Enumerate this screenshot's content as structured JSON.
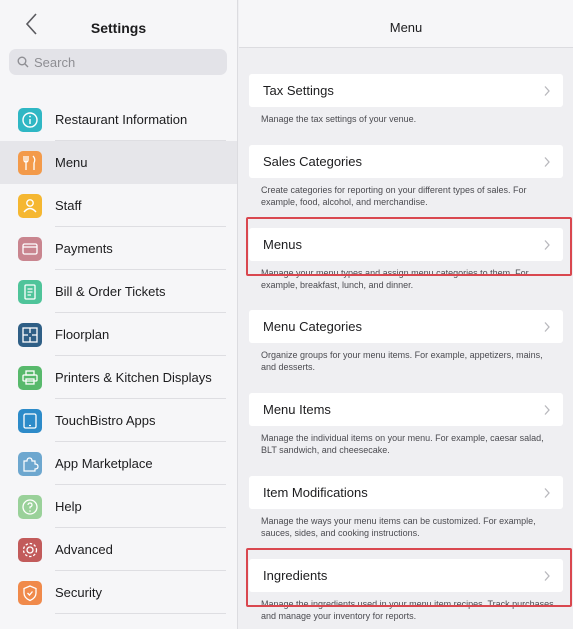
{
  "left": {
    "title": "Settings",
    "search_placeholder": "Search",
    "items": [
      {
        "label": "Restaurant Information",
        "icon": "info-icon",
        "color": "#2fb7c4",
        "selected": false
      },
      {
        "label": "Menu",
        "icon": "fork-knife-icon",
        "color": "#f39a4a",
        "selected": true
      },
      {
        "label": "Staff",
        "icon": "person-icon",
        "color": "#f5b731",
        "selected": false
      },
      {
        "label": "Payments",
        "icon": "wallet-icon",
        "color": "#c9858f",
        "selected": false
      },
      {
        "label": "Bill & Order Tickets",
        "icon": "receipt-icon",
        "color": "#4fc49a",
        "selected": false
      },
      {
        "label": "Floorplan",
        "icon": "floorplan-icon",
        "color": "#2f5f86",
        "selected": false
      },
      {
        "label": "Printers & Kitchen Displays",
        "icon": "printer-icon",
        "color": "#58b96c",
        "selected": false
      },
      {
        "label": "TouchBistro Apps",
        "icon": "tablet-icon",
        "color": "#2d8bc9",
        "selected": false
      },
      {
        "label": "App Marketplace",
        "icon": "puzzle-icon",
        "color": "#6da7cf",
        "selected": false
      },
      {
        "label": "Help",
        "icon": "help-icon",
        "color": "#9ad19a",
        "selected": false
      },
      {
        "label": "Advanced",
        "icon": "gear-icon",
        "color": "#c25b5b",
        "selected": false
      },
      {
        "label": "Security",
        "icon": "shield-icon",
        "color": "#f08a4b",
        "selected": false
      }
    ]
  },
  "right": {
    "title": "Menu",
    "groups": [
      {
        "label": "Tax Settings",
        "desc": "Manage the tax settings of your venue."
      },
      {
        "label": "Sales Categories",
        "desc": "Create categories for reporting on your different types of sales. For example, food, alcohol, and merchandise."
      },
      {
        "label": "Menus",
        "desc": "Manage your menu types and assign menu categories to them. For example, breakfast, lunch, and dinner.",
        "highlighted": true
      },
      {
        "label": "Menu Categories",
        "desc": "Organize groups for your menu items. For example, appetizers, mains, and desserts."
      },
      {
        "label": "Menu Items",
        "desc": "Manage the individual items on your menu. For example, caesar salad, BLT sandwich, and cheesecake."
      },
      {
        "label": "Item Modifications",
        "desc": "Manage the ways your menu items can be customized. For example, sauces, sides, and cooking instructions."
      },
      {
        "label": "Ingredients",
        "desc": "Manage the ingredients used in your menu item recipes. Track purchases and manage your inventory for reports.",
        "highlighted": true
      }
    ]
  },
  "colors": {
    "highlight": "#d9474f",
    "accent": "#007aff"
  }
}
